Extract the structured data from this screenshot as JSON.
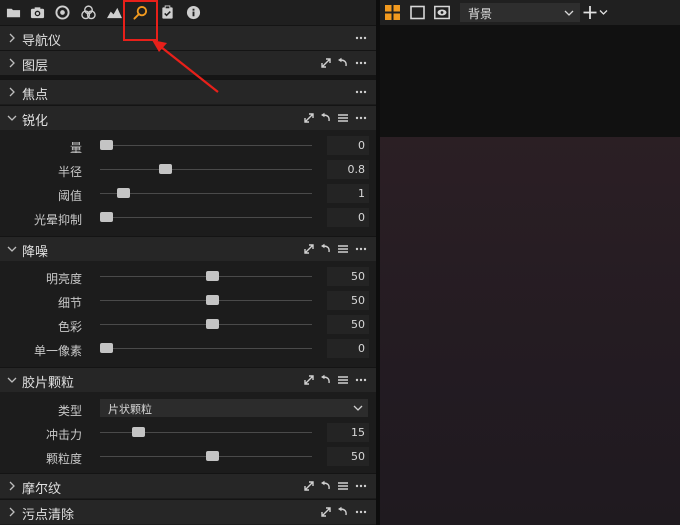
{
  "toolbar": {
    "tools": [
      {
        "name": "folder-icon"
      },
      {
        "name": "camera-icon"
      },
      {
        "name": "color-wheel-icon"
      },
      {
        "name": "color-circles-icon"
      },
      {
        "name": "exposure-icon"
      },
      {
        "name": "details-magnifier-icon",
        "active": true
      },
      {
        "name": "clipboard-icon"
      },
      {
        "name": "info-icon"
      }
    ]
  },
  "panels": {
    "navigator": {
      "title": "导航仪"
    },
    "layers": {
      "title": "图层"
    },
    "focus": {
      "title": "焦点"
    },
    "sharpening": {
      "title": "锐化",
      "rows": [
        {
          "label": "量",
          "value": "0",
          "level": 0
        },
        {
          "label": "半径",
          "value": "0.8",
          "level": 0.28
        },
        {
          "label": "阈值",
          "value": "1",
          "level": 0.08
        },
        {
          "label": "光晕抑制",
          "value": "0",
          "level": 0
        }
      ]
    },
    "noise": {
      "title": "降噪",
      "rows": [
        {
          "label": "明亮度",
          "value": "50",
          "level": 0.5
        },
        {
          "label": "细节",
          "value": "50",
          "level": 0.5
        },
        {
          "label": "色彩",
          "value": "50",
          "level": 0.5
        },
        {
          "label": "单一像素",
          "value": "0",
          "level": 0
        }
      ]
    },
    "grain": {
      "title": "胶片颗粒",
      "type_label": "类型",
      "type_value": "片状颗粒",
      "rows": [
        {
          "label": "冲击力",
          "value": "15",
          "level": 0.15
        },
        {
          "label": "颗粒度",
          "value": "50",
          "level": 0.5
        }
      ]
    },
    "moire": {
      "title": "摩尔纹"
    },
    "spot": {
      "title": "污点清除"
    }
  },
  "viewer_toolbar": {
    "background_select": "背景"
  },
  "colors": {
    "accent": "#f29a1f",
    "annotation": "#e8201a"
  }
}
